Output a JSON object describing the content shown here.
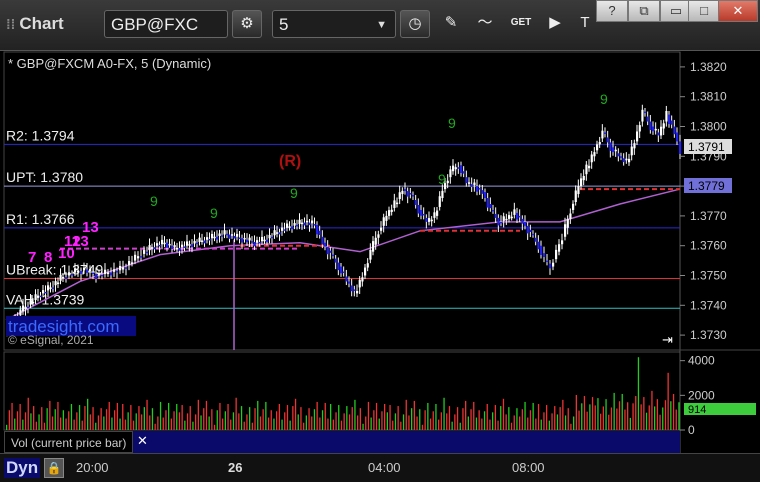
{
  "toolbar": {
    "app_title": "Chart",
    "symbol": "GBP@FXC",
    "interval": "5",
    "get_label": "GET",
    "help": "?",
    "restore": "⧉",
    "minimize": "▭",
    "maximize": "□",
    "close": "✕"
  },
  "chart_data": {
    "type": "candlestick",
    "title": "* GBP@FXCM A0-FX, 5 (Dynamic)",
    "watermark": "tradesight.com",
    "copyright": "© eSignal, 2021",
    "y_axis": {
      "min": 1.3725,
      "max": 1.3825,
      "ticks": [
        "1.3820",
        "1.3810",
        "1.3800",
        "1.3790",
        "1.3780",
        "1.3770",
        "1.3760",
        "1.3750",
        "1.3740",
        "1.3730"
      ]
    },
    "levels": [
      {
        "label": "R2: 1.3794",
        "value": 1.3794,
        "color": "#2a2ad0"
      },
      {
        "label": "UPT: 1.3780",
        "value": 1.378,
        "color": "#9a9ae0"
      },
      {
        "label": "R1: 1.3766",
        "value": 1.3766,
        "color": "#2a2ad0"
      },
      {
        "label": "UBreak: 1.3749",
        "value": 1.3749,
        "color": "#e03030"
      },
      {
        "label": "VAH: 1.3739",
        "value": 1.3739,
        "color": "#30c0c0"
      }
    ],
    "last_price": "1.3791",
    "poc_price": "1.3779",
    "r_marker": "(R)",
    "count_labels": [
      "9",
      "9",
      "9",
      "9",
      "9",
      "9",
      "10",
      "11",
      "12",
      "13",
      "13",
      "8",
      "7"
    ],
    "x_ticks": [
      "20:00",
      "26",
      "04:00",
      "08:00"
    ],
    "volume": {
      "label": "Vol (current price bar)",
      "ticks": [
        "4000",
        "2000",
        "0"
      ],
      "last": "914",
      "max": 4500
    }
  },
  "bottom": {
    "dyn": "Dyn",
    "lock": "🔒"
  }
}
